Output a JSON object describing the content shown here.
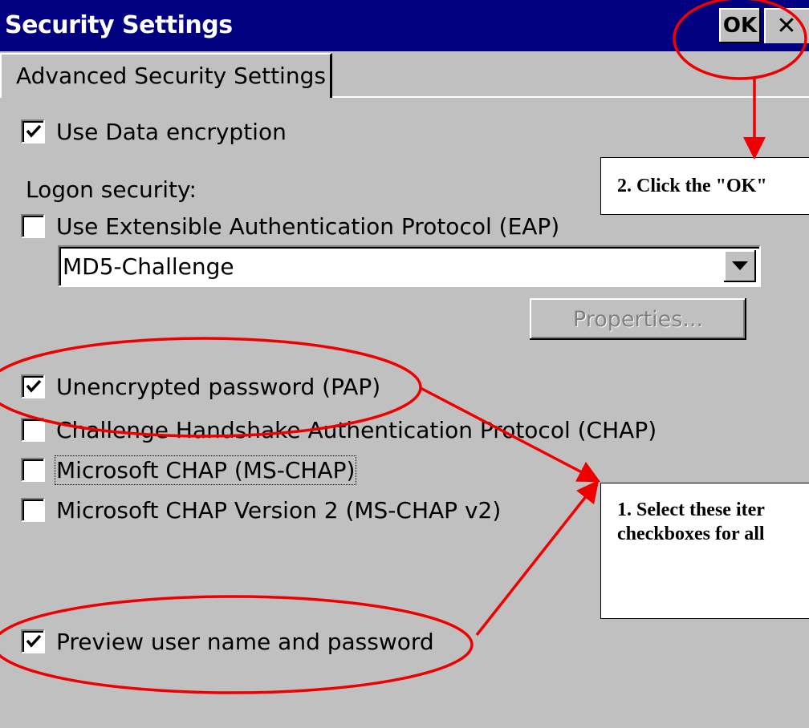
{
  "window": {
    "title": "Security Settings",
    "ok_label": "OK",
    "close_label": "✕"
  },
  "tabs": [
    {
      "label": "Advanced Security Settings",
      "selected": true
    }
  ],
  "settings": {
    "use_data_encryption": {
      "label": "Use Data encryption",
      "checked": true
    },
    "logon_security_label": "Logon security:",
    "use_eap": {
      "label": "Use Extensible Authentication Protocol (EAP)",
      "checked": false
    },
    "eap_type": {
      "value": "MD5-Challenge"
    },
    "properties_label": "Properties...",
    "pap": {
      "label": "Unencrypted password (PAP)",
      "checked": true
    },
    "chap": {
      "label": "Challenge Handshake Authentication Protocol (CHAP)",
      "checked": false
    },
    "ms_chap": {
      "label": "Microsoft CHAP (MS-CHAP)",
      "checked": false
    },
    "ms_chap_v2": {
      "label": "Microsoft CHAP Version 2 (MS-CHAP v2)",
      "checked": false
    },
    "preview": {
      "label": "Preview user name and password",
      "checked": true
    }
  },
  "annotations": {
    "ok_callout": "2. Click the \"OK\"",
    "select_callout_line1": "1. Select these iter",
    "select_callout_line2": "checkboxes for all",
    "color": "#ee0000"
  },
  "colors": {
    "titlebar": "#000080",
    "face": "#c0c0c0"
  }
}
